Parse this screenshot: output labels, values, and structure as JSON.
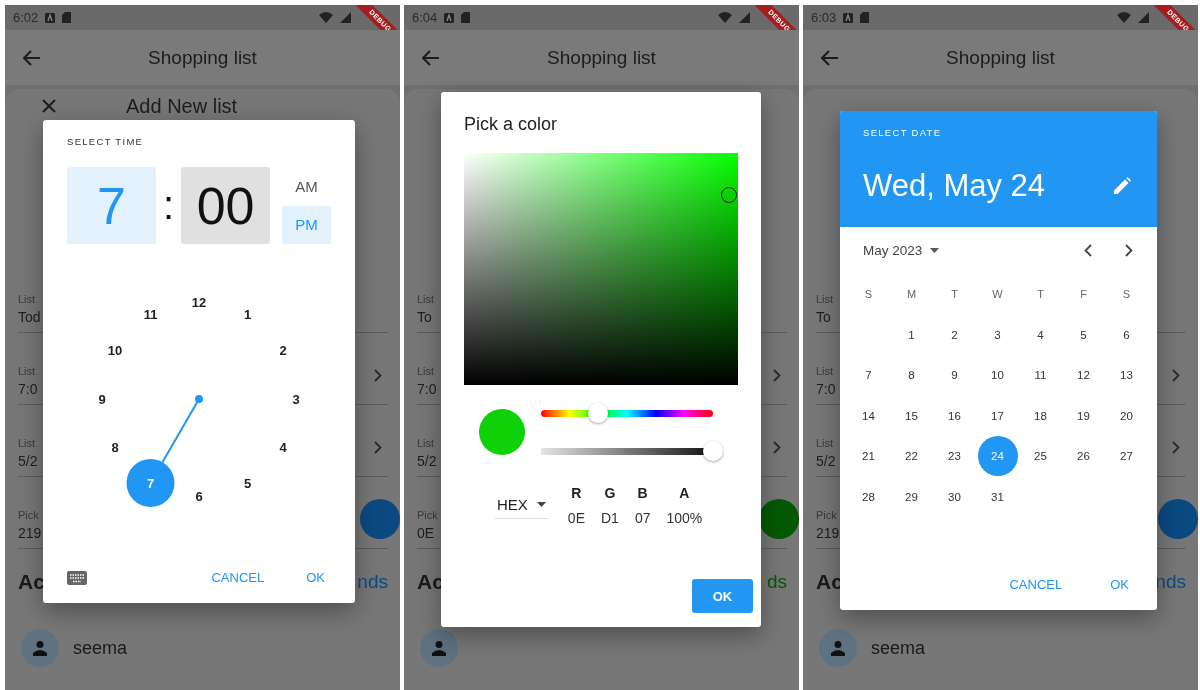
{
  "phones": [
    {
      "status_time": "6:02",
      "banner": "DEBUG",
      "app_title": "Shopping list",
      "sheet_title": "Add New list",
      "fields": [
        {
          "kind": "text",
          "label": "List",
          "value": "Tod"
        },
        {
          "kind": "chevron",
          "label": "List",
          "value": "7:0"
        },
        {
          "kind": "chevron",
          "label": "List",
          "value": "5/2"
        },
        {
          "kind": "button",
          "label": "Pick",
          "value": "219"
        }
      ],
      "section_title": "Ac",
      "section_action": "nds",
      "color": "#0b4a80",
      "member": "seema",
      "dialog": {
        "kind": "time",
        "title": "SELECT TIME",
        "hour": {
          "value": "7",
          "selected": true
        },
        "separator": ":",
        "minute": {
          "value": "00",
          "selected": false
        },
        "periods": [
          {
            "label": "AM",
            "selected": false
          },
          {
            "label": "PM",
            "selected": true
          }
        ],
        "clock": [
          {
            "label": "12",
            "selected": false
          },
          {
            "label": "1",
            "selected": false
          },
          {
            "label": "2",
            "selected": false
          },
          {
            "label": "3",
            "selected": false
          },
          {
            "label": "4",
            "selected": false
          },
          {
            "label": "5",
            "selected": false
          },
          {
            "label": "6",
            "selected": false
          },
          {
            "label": "7",
            "selected": true
          },
          {
            "label": "8",
            "selected": false
          },
          {
            "label": "9",
            "selected": false
          },
          {
            "label": "10",
            "selected": false
          },
          {
            "label": "11",
            "selected": false
          }
        ],
        "buttons": [
          "CANCEL",
          "OK"
        ]
      }
    },
    {
      "status_time": "6:04",
      "banner": "DEBUG",
      "app_title": "Shopping list",
      "fields": [
        {
          "kind": "text",
          "label": "List",
          "value": "To"
        },
        {
          "kind": "chevron",
          "label": "List",
          "value": "7:0"
        },
        {
          "kind": "chevron",
          "label": "List",
          "value": "5/2"
        },
        {
          "kind": "button",
          "label": "Pick",
          "value": "0E"
        }
      ],
      "section_title": "Ac",
      "section_action": "ds",
      "color": "#045a03",
      "dialog": {
        "kind": "color",
        "title": "Pick a color",
        "preview": {
          "color": "#0ed107"
        },
        "hue": {
          "level": 0.33
        },
        "alpha": {
          "level": 1
        },
        "format": "HEX",
        "channels": [
          {
            "name": "R",
            "value": "0E"
          },
          {
            "name": "G",
            "value": "D1"
          },
          {
            "name": "B",
            "value": "07"
          },
          {
            "name": "A",
            "value": "100%"
          }
        ],
        "buttons": [
          "OK"
        ]
      }
    },
    {
      "status_time": "6:03",
      "banner": "DEBUG",
      "app_title": "Shopping list",
      "fields": [
        {
          "kind": "text",
          "label": "List",
          "value": "To"
        },
        {
          "kind": "chevron",
          "label": "List",
          "value": "7:0"
        },
        {
          "kind": "chevron",
          "label": "List",
          "value": "5/2"
        },
        {
          "kind": "button",
          "label": "Pick",
          "value": "219"
        }
      ],
      "section_title": "Ac",
      "section_action": "nds",
      "color": "#0b4a80",
      "member": "seema",
      "dialog": {
        "kind": "date",
        "title": "SELECT DATE",
        "date": "Wed, May 24",
        "month": "May 2023",
        "weekdays": [
          "S",
          "M",
          "T",
          "W",
          "T",
          "F",
          "S"
        ],
        "weeks": [
          [
            {
              "label": "1",
              "selected": false
            },
            {
              "label": "2",
              "selected": false
            },
            {
              "label": "3",
              "selected": false
            },
            {
              "label": "4",
              "selected": false
            },
            {
              "label": "5",
              "selected": false
            },
            {
              "label": "6",
              "selected": false
            }
          ],
          [
            {
              "label": "7",
              "selected": false
            },
            {
              "label": "8",
              "selected": false
            },
            {
              "label": "9",
              "selected": false
            },
            {
              "label": "10",
              "selected": false
            },
            {
              "label": "11",
              "selected": false
            },
            {
              "label": "12",
              "selected": false
            },
            {
              "label": "13",
              "selected": false
            }
          ],
          [
            {
              "label": "14",
              "selected": false
            },
            {
              "label": "15",
              "selected": false
            },
            {
              "label": "16",
              "selected": false
            },
            {
              "label": "17",
              "selected": false
            },
            {
              "label": "18",
              "selected": false
            },
            {
              "label": "19",
              "selected": false
            },
            {
              "label": "20",
              "selected": false
            }
          ],
          [
            {
              "label": "21",
              "selected": false
            },
            {
              "label": "22",
              "selected": false
            },
            {
              "label": "23",
              "selected": false
            },
            {
              "label": "24",
              "selected": true
            },
            {
              "label": "25",
              "selected": false
            },
            {
              "label": "26",
              "selected": false
            },
            {
              "label": "27",
              "selected": false
            }
          ],
          [
            {
              "label": "28",
              "selected": false
            },
            {
              "label": "29",
              "selected": false
            },
            {
              "label": "30",
              "selected": false
            },
            {
              "label": "31",
              "selected": false
            }
          ]
        ],
        "buttons": [
          "CANCEL",
          "OK"
        ]
      }
    }
  ]
}
